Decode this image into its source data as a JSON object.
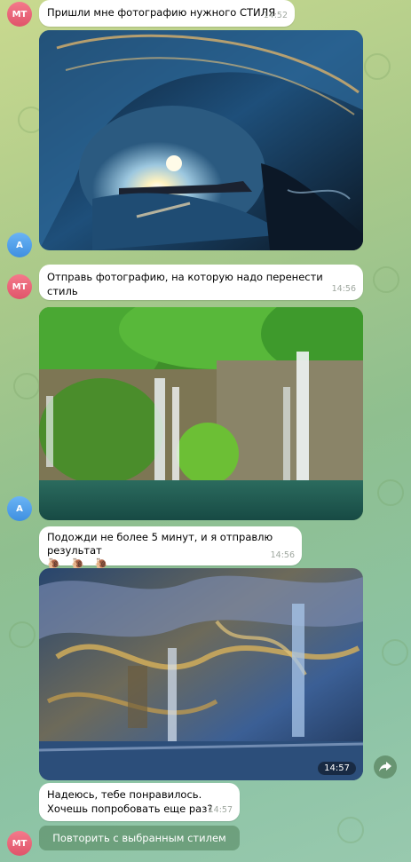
{
  "messages": [
    {
      "text": "Пришли мне фотографию нужного СТИЛЯ",
      "time": "14:52"
    },
    {
      "text": "Отправь фотографию, на которую надо перенести стиль",
      "time": "14:56"
    },
    {
      "text": "Подожди не более 5 минут, и я отправлю результат",
      "emojis": [
        "🐌",
        "🐌",
        "🐌"
      ],
      "time": "14:56"
    },
    {
      "text_line1": "Надеюсь, тебе понравилось.",
      "text_line2": "Хочешь попробовать еще раз?",
      "time": "14:57"
    }
  ],
  "photos": [
    {
      "icon": "wave-photo"
    },
    {
      "icon": "waterfall-photo"
    },
    {
      "icon": "stylized-waterfall-photo",
      "time": "14:57"
    }
  ],
  "avatars": {
    "bot": "MT",
    "user": "A"
  },
  "inline_button": {
    "label": "Повторить с выбранным стилем"
  },
  "colors": {
    "bot_avatar": "#e0546a",
    "user_avatar": "#3f8fe0",
    "bubble": "#ffffff"
  }
}
